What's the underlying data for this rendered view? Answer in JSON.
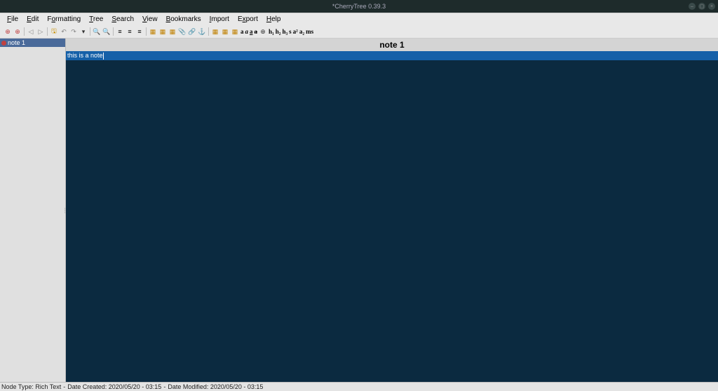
{
  "window": {
    "title": "*CherryTree 0.39.3"
  },
  "menu": {
    "file": "File",
    "edit": "Edit",
    "formatting": "Formatting",
    "tree": "Tree",
    "search": "Search",
    "view": "View",
    "bookmarks": "Bookmarks",
    "import": "Import",
    "export": "Export",
    "help": "Help"
  },
  "tree": {
    "items": [
      {
        "label": "note 1"
      }
    ]
  },
  "editor": {
    "node_title": "note 1",
    "content": "this is a note"
  },
  "status": {
    "node_type": "Node Type: Rich Text",
    "sep": "-",
    "created": "Date Created: 2020/05/20 - 03:15",
    "modified": "Date Modified: 2020/05/20 - 03:15"
  },
  "icons": {
    "minimize": "–",
    "maximize": "▢",
    "close": "×"
  },
  "toolbar": {
    "h1": "h₁",
    "h2": "h₂",
    "h3": "h₃",
    "small": "s",
    "sup": "a²",
    "sub": "a₂",
    "mono": "ms",
    "bold": "a",
    "italic": "a",
    "underline": "a",
    "strike": "a"
  }
}
